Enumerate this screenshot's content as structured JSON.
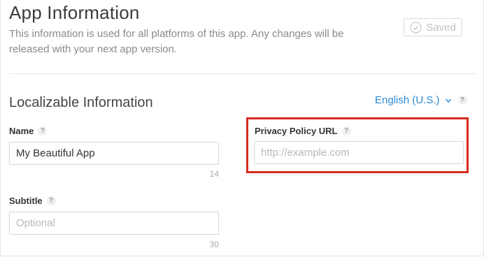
{
  "header": {
    "title": "App Information",
    "description": "This information is used for all platforms of this app. Any changes will be released with your next app version.",
    "saved_label": "Saved"
  },
  "localizable": {
    "section_title": "Localizable Information",
    "language": "English (U.S.)",
    "help": "?",
    "name": {
      "label": "Name",
      "value": "My Beautiful App",
      "counter": "14"
    },
    "subtitle": {
      "label": "Subtitle",
      "placeholder": "Optional",
      "counter": "30"
    },
    "privacy_policy": {
      "label": "Privacy Policy URL",
      "placeholder": "http://example.com"
    }
  },
  "colors": {
    "accent": "#2a8bd7",
    "highlight": "#d62b1f"
  },
  "icons": [
    "check-circle-icon",
    "chevron-down-icon",
    "help-icon"
  ]
}
